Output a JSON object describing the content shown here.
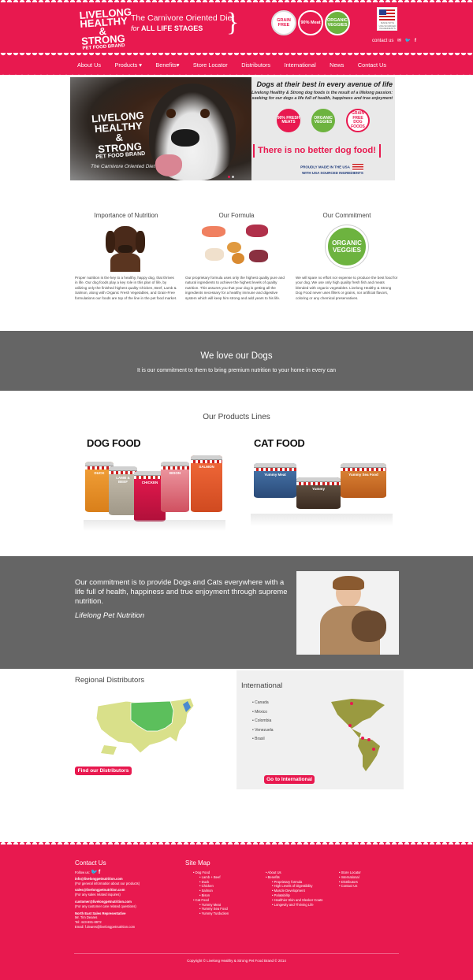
{
  "header": {
    "logo": {
      "line1": "LIVELONG",
      "line2": "HEALTHY &",
      "line3": "STRONG",
      "line4": "PET FOOD BRAND"
    },
    "tagline": {
      "line1": "The Carnivore Oriented Diet",
      "line2_prefix": "for",
      "line2_main": "ALL LIFE STAGES"
    },
    "badges": [
      {
        "label": "GRAIN FREE",
        "color": "#e8194f"
      },
      {
        "label": "90% Meat",
        "color": "#e8194f"
      },
      {
        "label": "ORGANIC VEGGIES",
        "color": "#6db33f"
      }
    ],
    "flag_caption": "MADE WITH USA SOURCED INGREDIENTS",
    "contact_label": "contact us"
  },
  "nav": {
    "items": [
      "About Us",
      "Products",
      "Benefits",
      "Store Locator",
      "Distributors",
      "International",
      "News",
      "Contact Us"
    ]
  },
  "hero": {
    "logo": {
      "line1": "LIVELONG",
      "line2": "HEALTHY &",
      "line3": "STRONG",
      "line4": "PET FOOD BRAND"
    },
    "subtitle": "The Carnivore Oriented Diet",
    "title": "Dogs at their best in every avenue of life",
    "text": "Livelong Healthy & Strong dog foods is the result of a lifelong passion: seeking for our dogs a life full of health, happiness and true enjoyment",
    "badges": [
      "90% FRESH MEATS",
      "ORGANIC VEGGIES",
      "GRAIN FREE DOG FOODS"
    ],
    "slogan": "There is no better dog food!",
    "made_in": "PROUDLY MADE IN THE USA",
    "sourced": "WITH USA SOURCED INGREDIENTS"
  },
  "features": [
    {
      "title": "Importance of Nutrition",
      "text": "Proper nutrition is the key to a healthy, happy dog, that thrives in life. Our dog foods play a key role in this plan of life, by utilizing only the finished highest quality Chicken, Beef, Lamb & Salmon, along with Organic Fresh Vegetables, and Grain-Free formulations our foods are top of the line in the pet food market."
    },
    {
      "title": "Our Formula",
      "text": "Our proprietary formula uses only the highest quality pure and natural ingredients to achieve the highest levels of quality nutrition. This assures you that your dog is getting all the ingredients necessary for a healthy immune and digestive system which will keep him strong and add years to his life."
    },
    {
      "title": "Our Commitment",
      "text": "We will spare no effort nor expense to produce the best food for your dog. We use only high quality fresh fish and meats blended with organic vegetables. Livelong Healthy & Strong Dog Food never uses fillers or grains, nor artificial flavors, coloring or any chemical preservatives."
    }
  ],
  "commitment_badge": "ORGANIC VEGGIES",
  "love": {
    "title": "We love our Dogs",
    "subtitle": "It is our commitment to them to bring premium nutrition to your home in every can"
  },
  "products": {
    "title": "Our Products Lines",
    "dog_label": "DOG FOOD",
    "cat_label": "CAT FOOD",
    "dog_cans": [
      "DUCK",
      "LAMB & BEEF",
      "CHICKEN",
      "SALMON",
      "BISON"
    ],
    "cat_cans": [
      "Yummy Meat",
      "Yummy",
      "Yummy Sea Food"
    ]
  },
  "mission": {
    "text": "Our commitment is to provide Dogs and Cats everywhere with a life full of health, happiness and true enjoyment through supreme nutrition.",
    "signature": "Lifelong Pet Nutrition"
  },
  "regional": {
    "title": "Regional Distributors",
    "button": "Find our Distributors"
  },
  "international": {
    "title": "International",
    "countries": [
      "Canada",
      "México",
      "Colombia",
      "Venezuela",
      "Brasil"
    ],
    "button": "Go to International"
  },
  "footer": {
    "contact": {
      "title": "Contact Us",
      "follow": "Follow us:",
      "entries": [
        {
          "email": "info@livelongpetnutrition.com",
          "note": "(For general information about our products)"
        },
        {
          "email": "sales@livelongpetnutrition.com",
          "note": "(For any sales related inquires)"
        },
        {
          "email": "customer@livelongpetnutrition.com",
          "note": "(For any customer care related questions)"
        }
      ],
      "rep_title": "North East Sales Representative",
      "rep_name": "Mr. Tim Deares",
      "rep_tel": "Tel: 443-691-8972",
      "rep_email": "Email: f.deares@livelongpetnutrition.com"
    },
    "sitemap": {
      "title": "Site Map",
      "col1": [
        {
          "label": "Dog Food",
          "level": 0
        },
        {
          "label": "Lamb + Beef",
          "level": 1
        },
        {
          "label": "Duck",
          "level": 1
        },
        {
          "label": "Chicken",
          "level": 1
        },
        {
          "label": "Salmon",
          "level": 1
        },
        {
          "label": "Bison",
          "level": 1
        },
        {
          "label": "Cat Food",
          "level": 0
        },
        {
          "label": "Yummy Meat",
          "level": 1
        },
        {
          "label": "Yummy Sea Food",
          "level": 1
        },
        {
          "label": "Yummy Turducken",
          "level": 1
        }
      ],
      "col2": [
        {
          "label": "About Us",
          "level": 0
        },
        {
          "label": "Benefits",
          "level": 0
        },
        {
          "label": "Proprietary formula",
          "level": 1
        },
        {
          "label": "High Levels of Digestibility",
          "level": 1
        },
        {
          "label": "Muscle Development",
          "level": 1
        },
        {
          "label": "Palatability",
          "level": 1
        },
        {
          "label": "Healthier Skin and Sleeker Coats",
          "level": 1
        },
        {
          "label": "Longevity and Thriving Life",
          "level": 1
        }
      ],
      "col3": [
        {
          "label": "Store Locator",
          "level": 0
        },
        {
          "label": "International",
          "level": 0
        },
        {
          "label": "Distributors",
          "level": 0
        },
        {
          "label": "Contact Us",
          "level": 0
        }
      ]
    },
    "copyright": "Copyright © Livelong Healthy & Strong Pet Food Brand © 2014"
  }
}
